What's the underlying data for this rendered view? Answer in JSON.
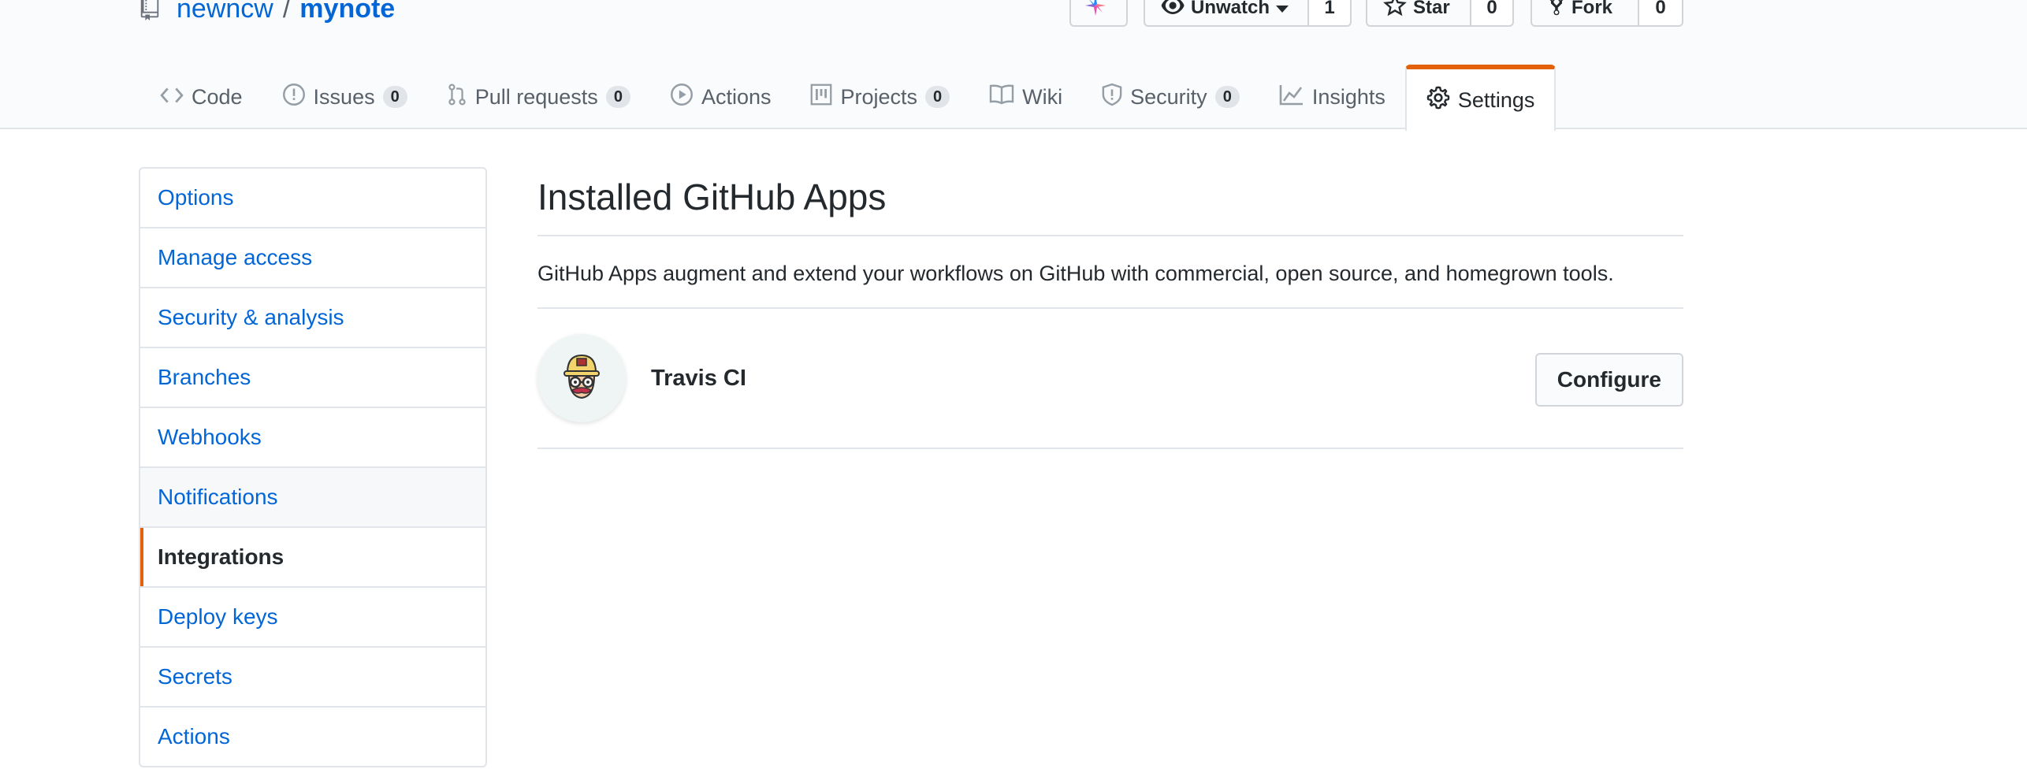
{
  "repo": {
    "owner": "newncw",
    "separator": "/",
    "name": "mynote"
  },
  "actions": {
    "sponsor_icon": "sparkle-icon",
    "watch": {
      "label": "Unwatch",
      "count": "1"
    },
    "star": {
      "label": "Star",
      "count": "0"
    },
    "fork": {
      "label": "Fork",
      "count": "0"
    }
  },
  "tabs": [
    {
      "label": "Code",
      "icon": "code-icon",
      "count": null
    },
    {
      "label": "Issues",
      "icon": "issue-icon",
      "count": "0"
    },
    {
      "label": "Pull requests",
      "icon": "pull-request-icon",
      "count": "0"
    },
    {
      "label": "Actions",
      "icon": "play-icon",
      "count": null
    },
    {
      "label": "Projects",
      "icon": "project-icon",
      "count": "0"
    },
    {
      "label": "Wiki",
      "icon": "book-icon",
      "count": null
    },
    {
      "label": "Security",
      "icon": "shield-icon",
      "count": "0"
    },
    {
      "label": "Insights",
      "icon": "graph-icon",
      "count": null
    },
    {
      "label": "Settings",
      "icon": "gear-icon",
      "count": null,
      "selected": true
    }
  ],
  "sidebar": {
    "items": [
      {
        "label": "Options"
      },
      {
        "label": "Manage access"
      },
      {
        "label": "Security & analysis"
      },
      {
        "label": "Branches"
      },
      {
        "label": "Webhooks"
      },
      {
        "label": "Notifications"
      },
      {
        "label": "Integrations",
        "selected": true
      },
      {
        "label": "Deploy keys"
      },
      {
        "label": "Secrets"
      },
      {
        "label": "Actions"
      }
    ]
  },
  "main": {
    "title": "Installed GitHub Apps",
    "description": "GitHub Apps augment and extend your workflows on GitHub with commercial, open source, and homegrown tools.",
    "apps": [
      {
        "name": "Travis CI",
        "action_label": "Configure"
      }
    ]
  },
  "colors": {
    "link": "#0366d6",
    "accent": "#e36209",
    "border": "#e1e4e8",
    "header_bg": "#fafbfc"
  }
}
